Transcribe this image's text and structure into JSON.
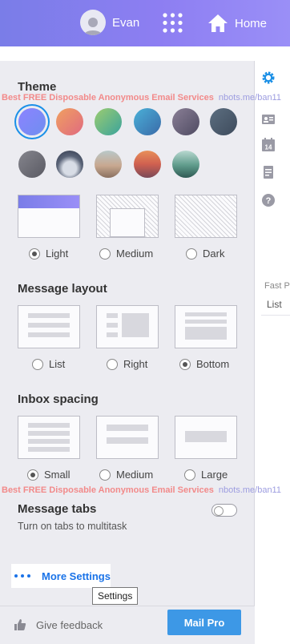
{
  "header": {
    "user_name": "Evan",
    "home_label": "Home"
  },
  "rail": {
    "fast_title": "Fast P",
    "fast_list": "List"
  },
  "watermark": {
    "text": "Best FREE Disposable Anonymous Email Services",
    "url": "nbots.me/ban11"
  },
  "theme": {
    "title": "Theme",
    "swatches": [
      {
        "name": "purple",
        "selected": true
      },
      {
        "name": "orange-pink"
      },
      {
        "name": "green"
      },
      {
        "name": "teal-blue"
      },
      {
        "name": "dusk-purple"
      },
      {
        "name": "slate"
      },
      {
        "name": "gray"
      },
      {
        "name": "cloudy-sky"
      },
      {
        "name": "beach"
      },
      {
        "name": "sunset"
      },
      {
        "name": "mountain"
      }
    ],
    "options": [
      {
        "label": "Light",
        "selected": true
      },
      {
        "label": "Medium",
        "selected": false
      },
      {
        "label": "Dark",
        "selected": false
      }
    ]
  },
  "message_layout": {
    "title": "Message layout",
    "options": [
      {
        "label": "List",
        "selected": false
      },
      {
        "label": "Right",
        "selected": false
      },
      {
        "label": "Bottom",
        "selected": true
      }
    ]
  },
  "inbox_spacing": {
    "title": "Inbox spacing",
    "options": [
      {
        "label": "Small",
        "selected": true
      },
      {
        "label": "Medium",
        "selected": false
      },
      {
        "label": "Large",
        "selected": false
      }
    ]
  },
  "message_tabs": {
    "title": "Message tabs",
    "description": "Turn on tabs to multitask",
    "enabled": false
  },
  "more_settings": {
    "label": "More Settings",
    "tooltip": "Settings"
  },
  "footer": {
    "feedback_label": "Give feedback",
    "mail_pro_label": "Mail Pro"
  },
  "colors": {
    "header": "#8a7ef0",
    "accent": "#1a73e8",
    "panel": "#ececf1",
    "button": "#3d98e6"
  }
}
